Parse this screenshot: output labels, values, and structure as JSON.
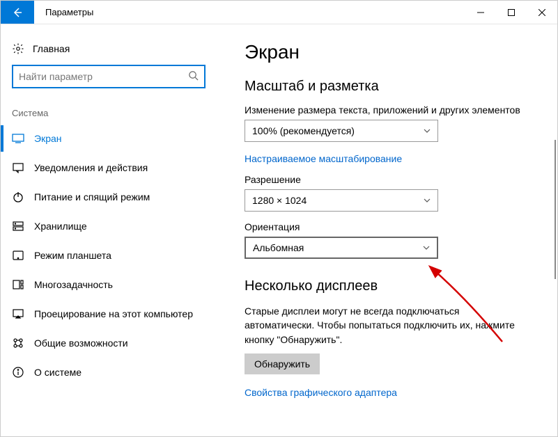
{
  "titlebar": {
    "title": "Параметры"
  },
  "sidebar": {
    "home": "Главная",
    "search_placeholder": "Найти параметр",
    "section": "Система",
    "items": [
      {
        "label": "Экран"
      },
      {
        "label": "Уведомления и действия"
      },
      {
        "label": "Питание и спящий режим"
      },
      {
        "label": "Хранилище"
      },
      {
        "label": "Режим планшета"
      },
      {
        "label": "Многозадачность"
      },
      {
        "label": "Проецирование на этот компьютер"
      },
      {
        "label": "Общие возможности"
      },
      {
        "label": "О системе"
      }
    ]
  },
  "content": {
    "title": "Экран",
    "scale_heading": "Масштаб и разметка",
    "scale_label": "Изменение размера текста, приложений и других элементов",
    "scale_value": "100% (рекомендуется)",
    "custom_scaling_link": "Настраиваемое масштабирование",
    "resolution_label": "Разрешение",
    "resolution_value": "1280 × 1024",
    "orientation_label": "Ориентация",
    "orientation_value": "Альбомная",
    "multi_heading": "Несколько дисплеев",
    "multi_desc": "Старые дисплеи могут не всегда подключаться автоматически. Чтобы попытаться подключить их, нажмите кнопку \"Обнаружить\".",
    "detect_btn": "Обнаружить",
    "gpu_link": "Свойства графического адаптера"
  }
}
